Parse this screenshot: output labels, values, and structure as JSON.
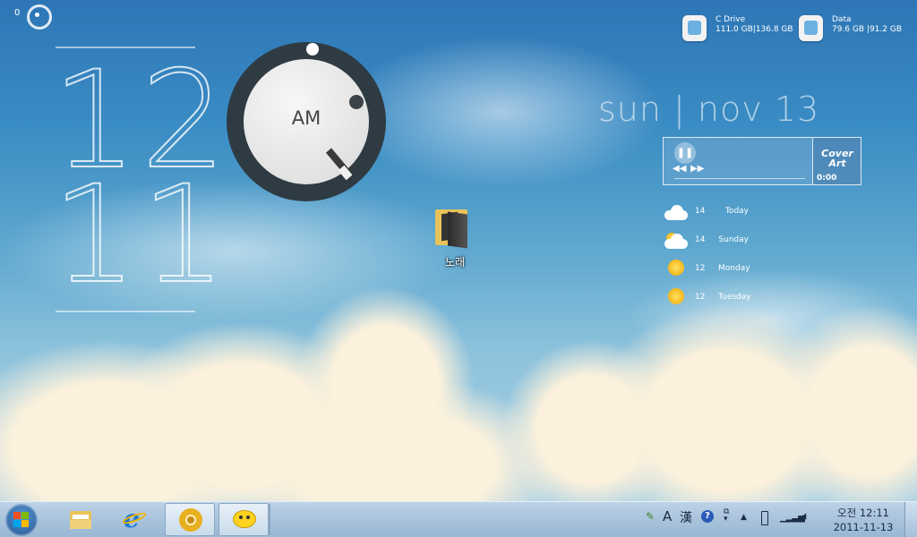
{
  "weather_small": {
    "temp": "0"
  },
  "clock": {
    "hour": "12",
    "minute": "11",
    "period": "AM"
  },
  "date": {
    "text": "sun | nov 13"
  },
  "drives": [
    {
      "name": "C Drive",
      "usage": "111.0 GB|136.8 GB"
    },
    {
      "name": "Data",
      "usage": "79.6 GB  |91.2 GB"
    }
  ],
  "media_player": {
    "cover_label": "Cover Art",
    "time": "0:00",
    "pause_icon": "pause-icon",
    "prev_icon": "rewind-icon",
    "next_icon": "fast-forward-icon"
  },
  "forecast": [
    {
      "temp": "14",
      "day": "Today",
      "icon": "cloudy-icon"
    },
    {
      "temp": "14",
      "day": "Sunday",
      "icon": "partly-cloudy-icon"
    },
    {
      "temp": "12",
      "day": "Monday",
      "icon": "sunny-icon"
    },
    {
      "temp": "12",
      "day": "Tuesday",
      "icon": "sunny-icon"
    }
  ],
  "desktop_icons": [
    {
      "label": "노래",
      "icon": "music-folder-icon"
    }
  ],
  "taskbar": {
    "start_icon": "windows-start-icon",
    "pinned": [
      {
        "name": "windows-explorer",
        "icon": "folder-icon"
      },
      {
        "name": "internet-explorer",
        "icon": "ie-icon"
      },
      {
        "name": "chrome",
        "icon": "chrome-icon"
      },
      {
        "name": "messenger",
        "icon": "chat-icon"
      }
    ],
    "tray": {
      "ime_a": "A",
      "ime_han": "漢"
    },
    "clock": {
      "time": "오전 12:11",
      "date": "2011-11-13"
    }
  },
  "colors": {
    "sky_top": "#2e76b6",
    "taskbar": "#a9c3dc",
    "dial_ring": "#2f3b43"
  }
}
